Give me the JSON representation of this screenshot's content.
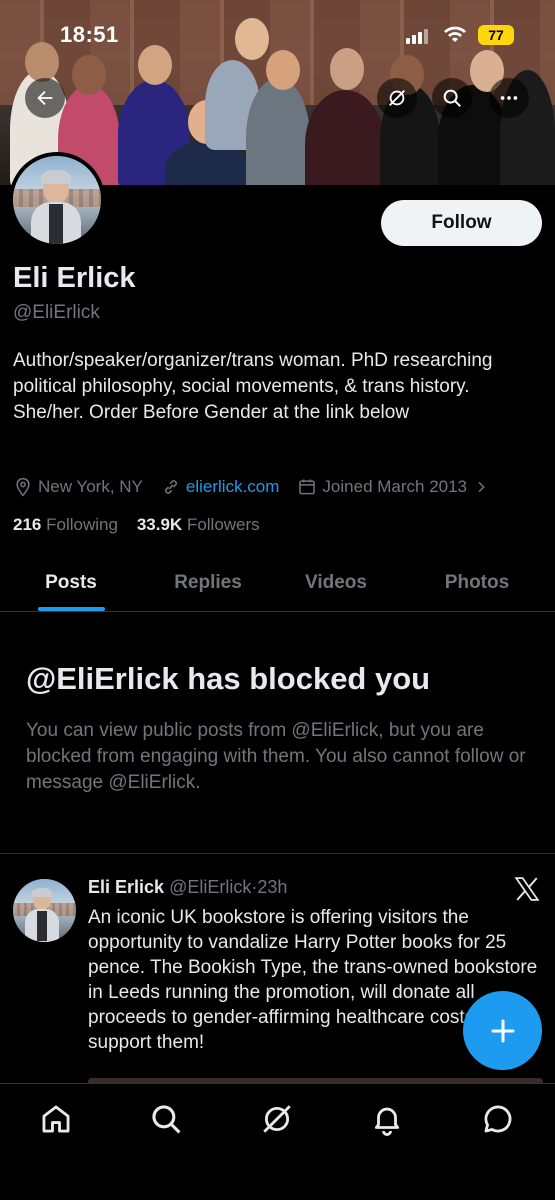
{
  "status_bar": {
    "time": "18:51",
    "battery": "77"
  },
  "profile": {
    "name": "Eli Erlick",
    "handle": "@EliErlick",
    "follow_label": "Follow",
    "bio": "Author/speaker/organizer/trans woman. PhD researching political philosophy, social movements, & trans history. She/her. Order Before Gender at the link below",
    "location": "New York, NY",
    "website": "elierlick.com",
    "joined": "Joined March 2013",
    "following_count": "216",
    "following_label": "Following",
    "followers_count": "33.9K",
    "followers_label": "Followers"
  },
  "tabs": [
    {
      "label": "Posts"
    },
    {
      "label": "Replies"
    },
    {
      "label": "Videos"
    },
    {
      "label": "Photos"
    }
  ],
  "blocked": {
    "title": "@EliErlick has blocked you",
    "message": "You can view public posts from @EliErlick, but you are blocked from engaging with them. You also cannot follow or message @EliErlick."
  },
  "tweet": {
    "author": "Eli Erlick",
    "handle": "@EliErlick",
    "time": "·23h",
    "text": "An iconic UK bookstore is offering visitors the opportunity to vandalize Harry Potter books for 25 pence. The Bookish Type, the trans-owned bookstore in Leeds running the promotion, will donate all proceeds to gender-affirming healthcare costs. Go support them!"
  },
  "icons": {
    "header": [
      "back-arrow-icon",
      "grok-icon",
      "search-icon",
      "more-icon"
    ],
    "nav": [
      "home-icon",
      "search-icon",
      "grok-icon",
      "notifications-icon",
      "messages-icon"
    ],
    "meta": [
      "location-icon",
      "link-icon",
      "calendar-icon",
      "chevron-right-icon"
    ]
  },
  "colors": {
    "accent": "#1d9bf0",
    "background": "#000000",
    "secondary_text": "#71767b",
    "primary_text": "#e7e9ea"
  }
}
